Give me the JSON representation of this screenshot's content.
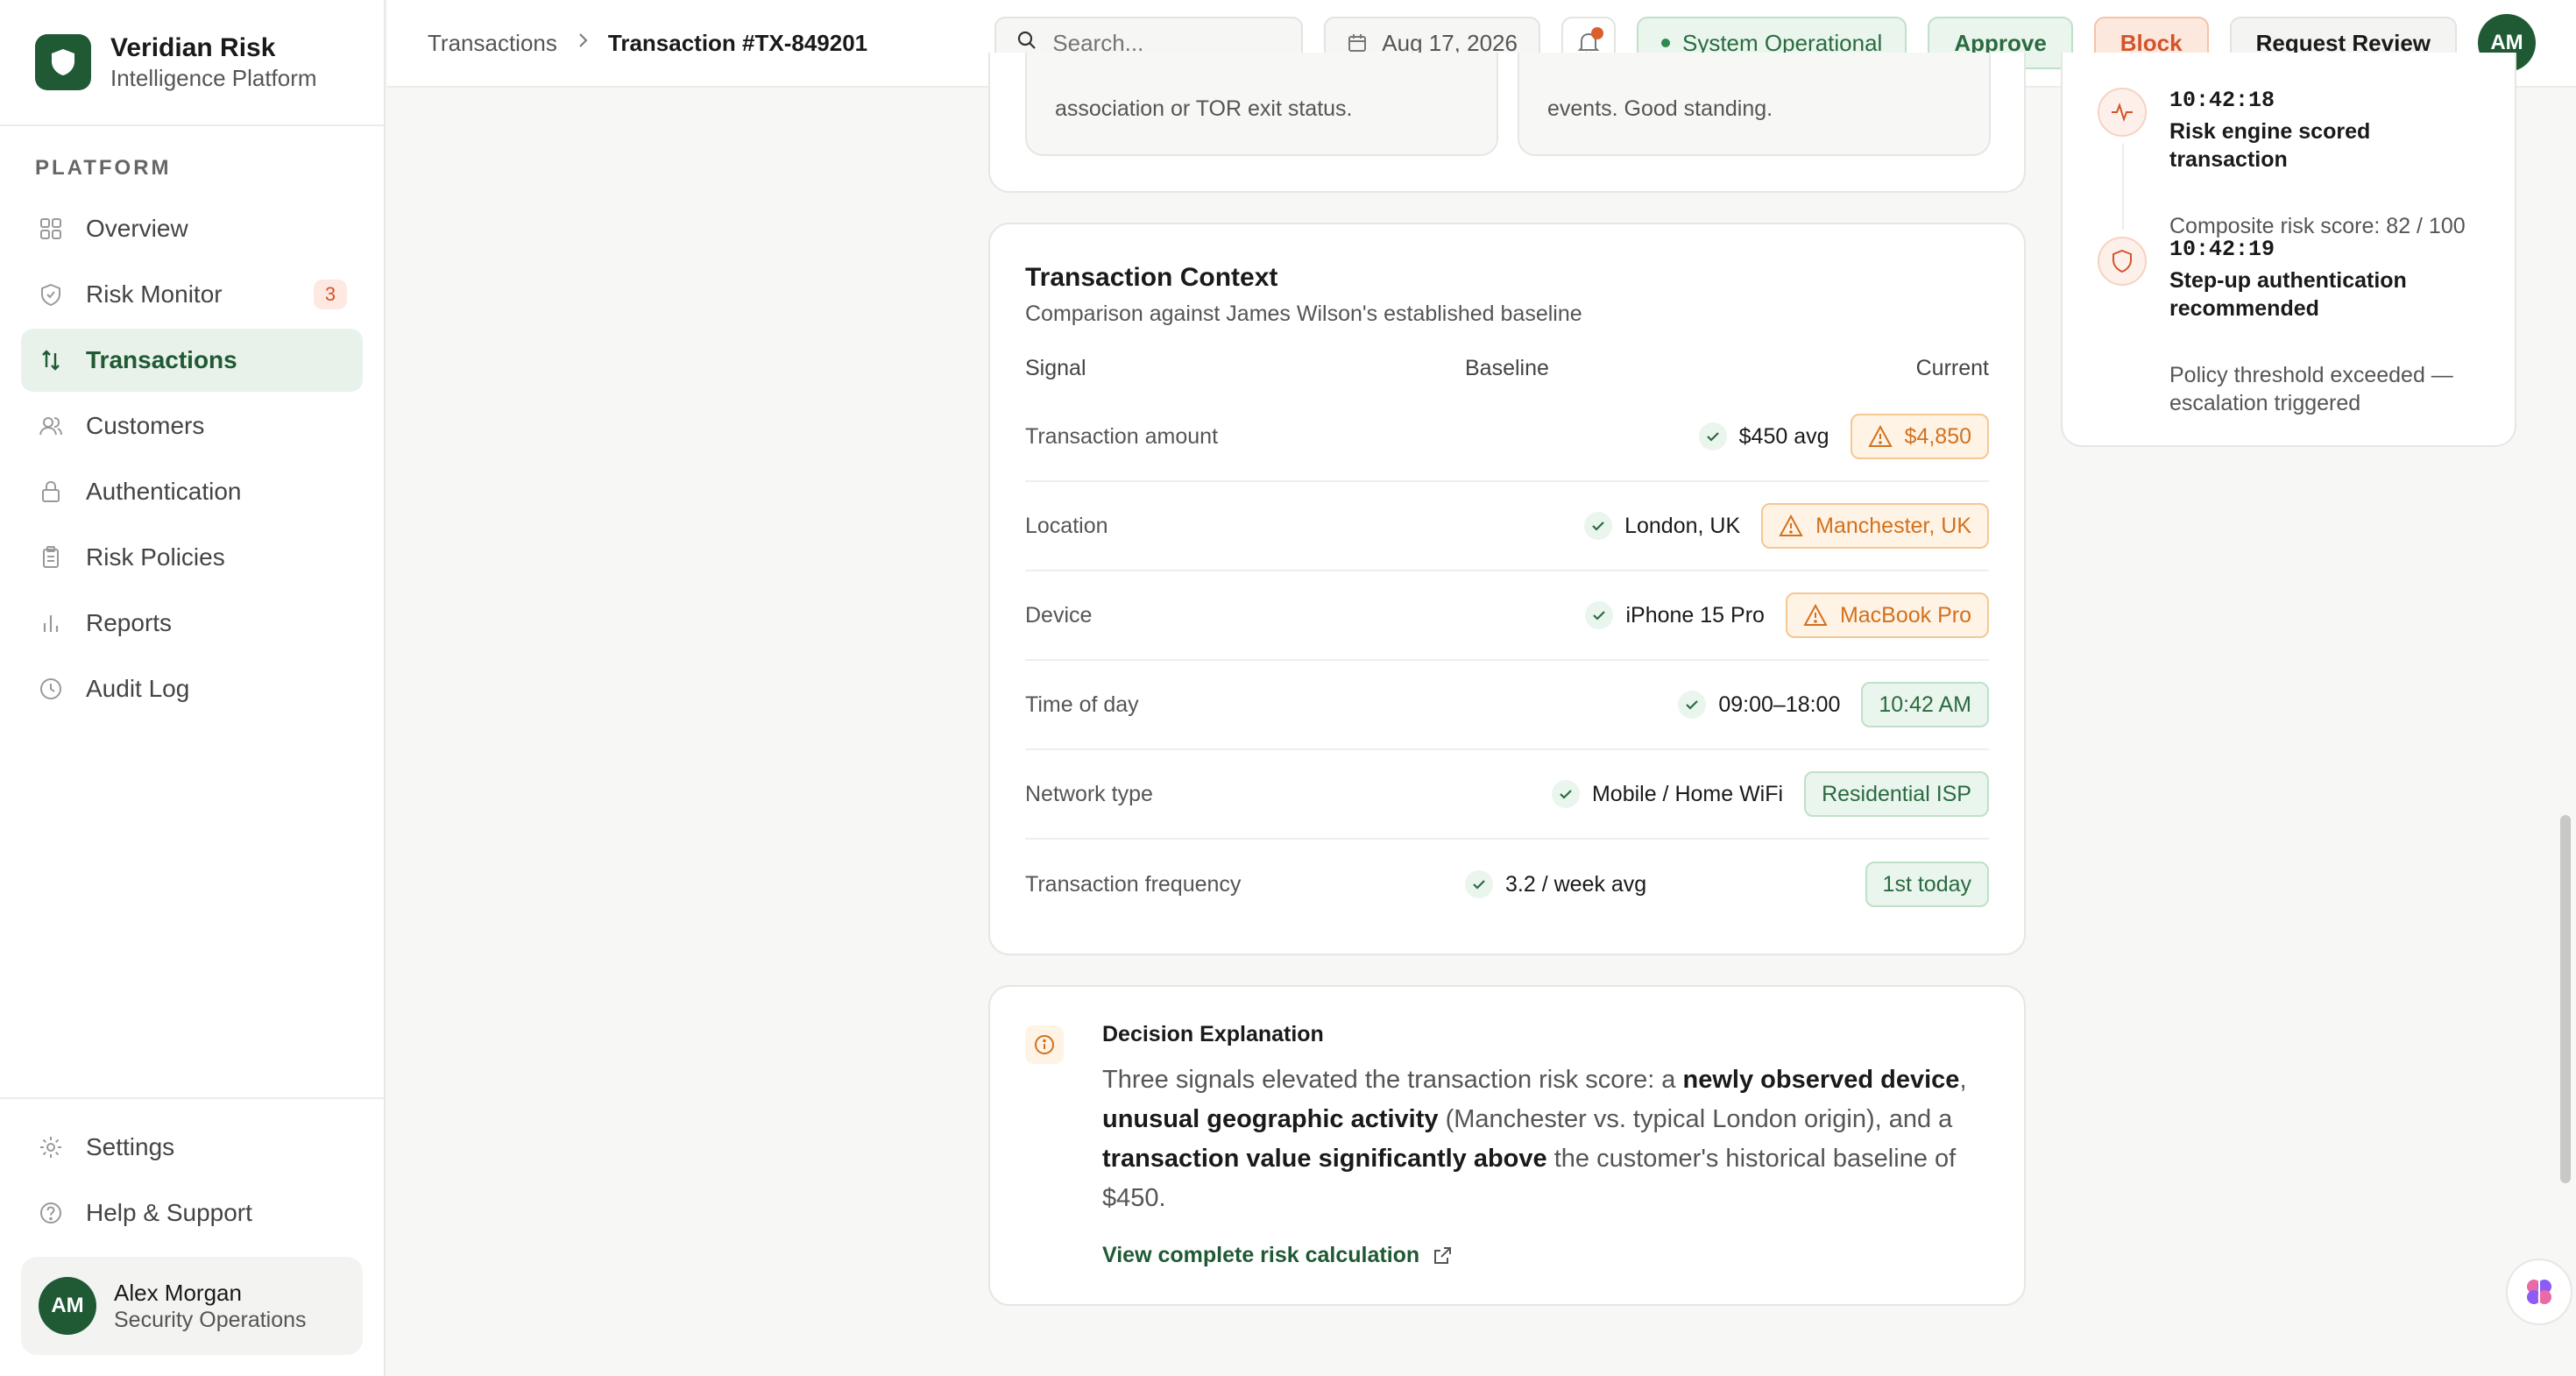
{
  "brand": {
    "title": "Veridian Risk",
    "subtitle": "Intelligence Platform"
  },
  "sidebar": {
    "section_label": "PLATFORM",
    "items": [
      {
        "label": "Overview",
        "icon": "grid-icon"
      },
      {
        "label": "Risk Monitor",
        "icon": "shield-icon",
        "badge": "3"
      },
      {
        "label": "Transactions",
        "icon": "arrows-updown-icon",
        "active": true
      },
      {
        "label": "Customers",
        "icon": "users-icon"
      },
      {
        "label": "Authentication",
        "icon": "lock-icon"
      },
      {
        "label": "Risk Policies",
        "icon": "clipboard-icon"
      },
      {
        "label": "Reports",
        "icon": "bar-chart-icon"
      },
      {
        "label": "Audit Log",
        "icon": "clock-icon"
      }
    ],
    "bottom_items": [
      {
        "label": "Settings",
        "icon": "gear-icon"
      },
      {
        "label": "Help & Support",
        "icon": "help-icon"
      }
    ],
    "user": {
      "initials": "AM",
      "name": "Alex Morgan",
      "role": "Security Operations"
    }
  },
  "topbar": {
    "breadcrumb": [
      "Transactions",
      "Transaction #TX-849201"
    ],
    "search_placeholder": "Search...",
    "date": "Aug 17, 2026",
    "status": "System Operational",
    "approve": "Approve",
    "block": "Block",
    "review": "Request Review",
    "avatar": "AM"
  },
  "top_cards": [
    {
      "text": "association or TOR exit status."
    },
    {
      "text": "events. Good standing."
    }
  ],
  "context": {
    "title": "Transaction Context",
    "subtitle": "Comparison against James Wilson's established baseline",
    "headers": {
      "signal": "Signal",
      "baseline": "Baseline",
      "current": "Current"
    },
    "rows": [
      {
        "signal": "Transaction amount",
        "baseline": "$450 avg",
        "current": "$4,850",
        "status": "warn"
      },
      {
        "signal": "Location",
        "baseline": "London, UK",
        "current": "Manchester, UK",
        "status": "warn"
      },
      {
        "signal": "Device",
        "baseline": "iPhone 15 Pro",
        "current": "MacBook Pro",
        "status": "warn"
      },
      {
        "signal": "Time of day",
        "baseline": "09:00–18:00",
        "current": "10:42 AM",
        "status": "ok"
      },
      {
        "signal": "Network type",
        "baseline": "Mobile / Home WiFi",
        "current": "Residential ISP",
        "status": "ok"
      },
      {
        "signal": "Transaction frequency",
        "baseline": "3.2 / week avg",
        "current": "1st today",
        "status": "ok"
      }
    ]
  },
  "timeline": [
    {
      "time": "10:42:18",
      "title": "Risk engine scored transaction",
      "desc": "Composite risk score: 82 / 100",
      "icon": "activity-icon"
    },
    {
      "time": "10:42:19",
      "title": "Step-up authentication recommended",
      "desc": "Policy threshold exceeded — escalation triggered",
      "icon": "shield-icon"
    }
  ],
  "explanation": {
    "title": "Decision Explanation",
    "p1": "Three signals elevated the transaction risk score: a ",
    "b1": "newly observed device",
    "p2": ", ",
    "b2": "unusual geographic activity",
    "p3": " (Manchester vs. typical London origin), and a ",
    "b3": "transaction value significantly above",
    "p4": " the customer's historical baseline of $450.",
    "link": "View complete risk calculation"
  },
  "colors": {
    "brand": "#1f5a34",
    "warn": "#d2711d",
    "ok": "#2a6b40",
    "block": "#d4542a"
  }
}
